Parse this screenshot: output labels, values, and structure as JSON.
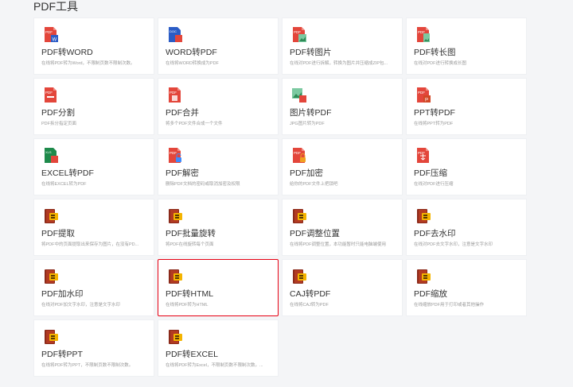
{
  "section_title": "PDF工具",
  "colors": {
    "accent_red": "#e60012",
    "pdf_red": "#e3463b",
    "word_blue": "#2b5cc6",
    "excel_green": "#1e8a4b",
    "book_brown": "#8b2a1a",
    "book_yellow": "#f4b400"
  },
  "tools": [
    {
      "name": "pdf-to-word",
      "title": "PDF转WORD",
      "desc": "在线将PDF转为Word，不限制页数不限制次数。",
      "icon": "pdf-to-word-icon",
      "selected": false
    },
    {
      "name": "word-to-pdf",
      "title": "WORD转PDF",
      "desc": "在线将WORD转换成为PDF",
      "icon": "word-to-pdf-icon",
      "selected": false
    },
    {
      "name": "pdf-to-image",
      "title": "PDF转图片",
      "desc": "在线对PDF进行拆解，转换为图片并压缩成ZIP包...",
      "icon": "pdf-to-image-icon",
      "selected": false
    },
    {
      "name": "pdf-to-long-image",
      "title": "PDF转长图",
      "desc": "在线对PDF进行转换成长图",
      "icon": "pdf-to-long-image-icon",
      "selected": false
    },
    {
      "name": "pdf-split",
      "title": "PDF分割",
      "desc": "PDF拆分指定页面",
      "icon": "pdf-split-icon",
      "selected": false
    },
    {
      "name": "pdf-merge",
      "title": "PDF合并",
      "desc": "将多个PDF文件合成一个文件",
      "icon": "pdf-merge-icon",
      "selected": false
    },
    {
      "name": "image-to-pdf",
      "title": "图片转PDF",
      "desc": "JPG图片转为PDF",
      "icon": "image-to-pdf-icon",
      "selected": false
    },
    {
      "name": "ppt-to-pdf",
      "title": "PPT转PDF",
      "desc": "在线将PPT转为PDF",
      "icon": "ppt-to-pdf-icon",
      "selected": false
    },
    {
      "name": "excel-to-pdf",
      "title": "EXCEL转PDF",
      "desc": "在线将EXCEL转为PDF",
      "icon": "excel-to-pdf-icon",
      "selected": false
    },
    {
      "name": "pdf-decrypt",
      "title": "PDF解密",
      "desc": "删除PDF文档的密码或取消加密及权限",
      "icon": "pdf-decrypt-icon",
      "selected": false
    },
    {
      "name": "pdf-encrypt",
      "title": "PDF加密",
      "desc": "给你的PDF文件上把锁吧",
      "icon": "pdf-encrypt-icon",
      "selected": false
    },
    {
      "name": "pdf-compress",
      "title": "PDF压缩",
      "desc": "在线对PDF进行压缩",
      "icon": "pdf-compress-icon",
      "selected": false
    },
    {
      "name": "pdf-extract",
      "title": "PDF提取",
      "desc": "将PDF中的页面提取出来保存为图片，在没有PD...",
      "icon": "book-icon",
      "selected": false
    },
    {
      "name": "pdf-batch-rotate",
      "title": "PDF批量旋转",
      "desc": "将PDF在线旋转每个页面",
      "icon": "book-icon",
      "selected": false
    },
    {
      "name": "pdf-adjust-position",
      "title": "PDF调整位置",
      "desc": "在线将PDF调整位置，本功能暂时只能电脑端使用",
      "icon": "book-icon",
      "selected": false
    },
    {
      "name": "pdf-remove-watermark",
      "title": "PDF去水印",
      "desc": "在线对PDF去文字水印，注意是文字水印",
      "icon": "book-icon",
      "selected": false
    },
    {
      "name": "pdf-add-watermark",
      "title": "PDF加水印",
      "desc": "在线对PDF加文字水印，注意是文字水印",
      "icon": "book-icon",
      "selected": false
    },
    {
      "name": "pdf-to-html",
      "title": "PDF转HTML",
      "desc": "在线将PDF转为HTML",
      "icon": "book-icon",
      "selected": true
    },
    {
      "name": "caj-to-pdf",
      "title": "CAJ转PDF",
      "desc": "在线将CAJ转为PDF",
      "icon": "book-icon",
      "selected": false
    },
    {
      "name": "pdf-scale",
      "title": "PDF缩放",
      "desc": "在线缩放PDF用于打印或者其他操作",
      "icon": "book-icon",
      "selected": false
    },
    {
      "name": "pdf-to-ppt",
      "title": "PDF转PPT",
      "desc": "在线将PDF转为PPT，不限制页数不限制次数。",
      "icon": "book-icon",
      "selected": false
    },
    {
      "name": "pdf-to-excel",
      "title": "PDF转EXCEL",
      "desc": "在线将PDF转为Excel，不限制页数不限制次数。...",
      "icon": "book-icon",
      "selected": false
    }
  ]
}
